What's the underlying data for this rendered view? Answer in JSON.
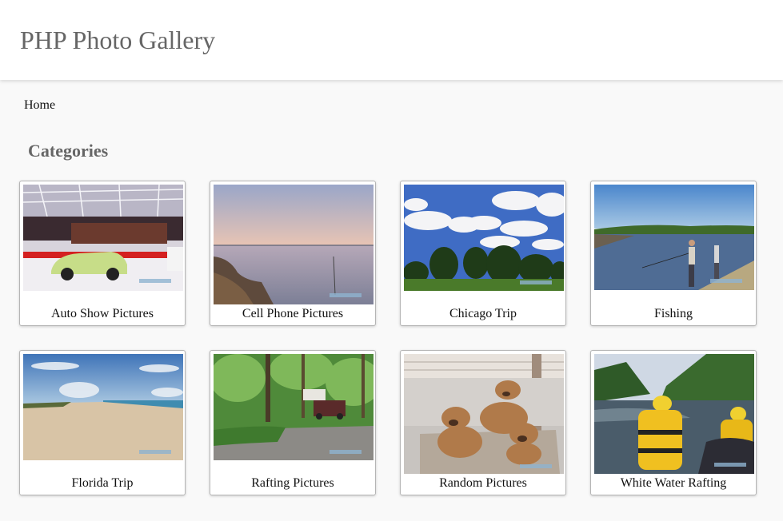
{
  "header": {
    "site_title": "PHP Photo Gallery"
  },
  "breadcrumb": {
    "home": "Home"
  },
  "categories": {
    "title": "Categories",
    "items": [
      {
        "label": "Auto Show Pictures",
        "image": "auto-show-photo"
      },
      {
        "label": "Cell Phone Pictures",
        "image": "lake-sunset-photo"
      },
      {
        "label": "Chicago Trip",
        "image": "trees-clouds-photo"
      },
      {
        "label": "Fishing",
        "image": "fishing-lake-photo"
      },
      {
        "label": "Florida Trip",
        "image": "beach-photo"
      },
      {
        "label": "Rafting Pictures",
        "image": "campsite-photo"
      },
      {
        "label": "Random Pictures",
        "image": "puppies-photo"
      },
      {
        "label": "White Water Rafting",
        "image": "river-rafting-photo"
      }
    ]
  },
  "colors": {
    "header_bg": "#ffffff",
    "page_bg": "#f9f9f9",
    "title_text": "#666666",
    "card_border": "#b5b5b5"
  }
}
